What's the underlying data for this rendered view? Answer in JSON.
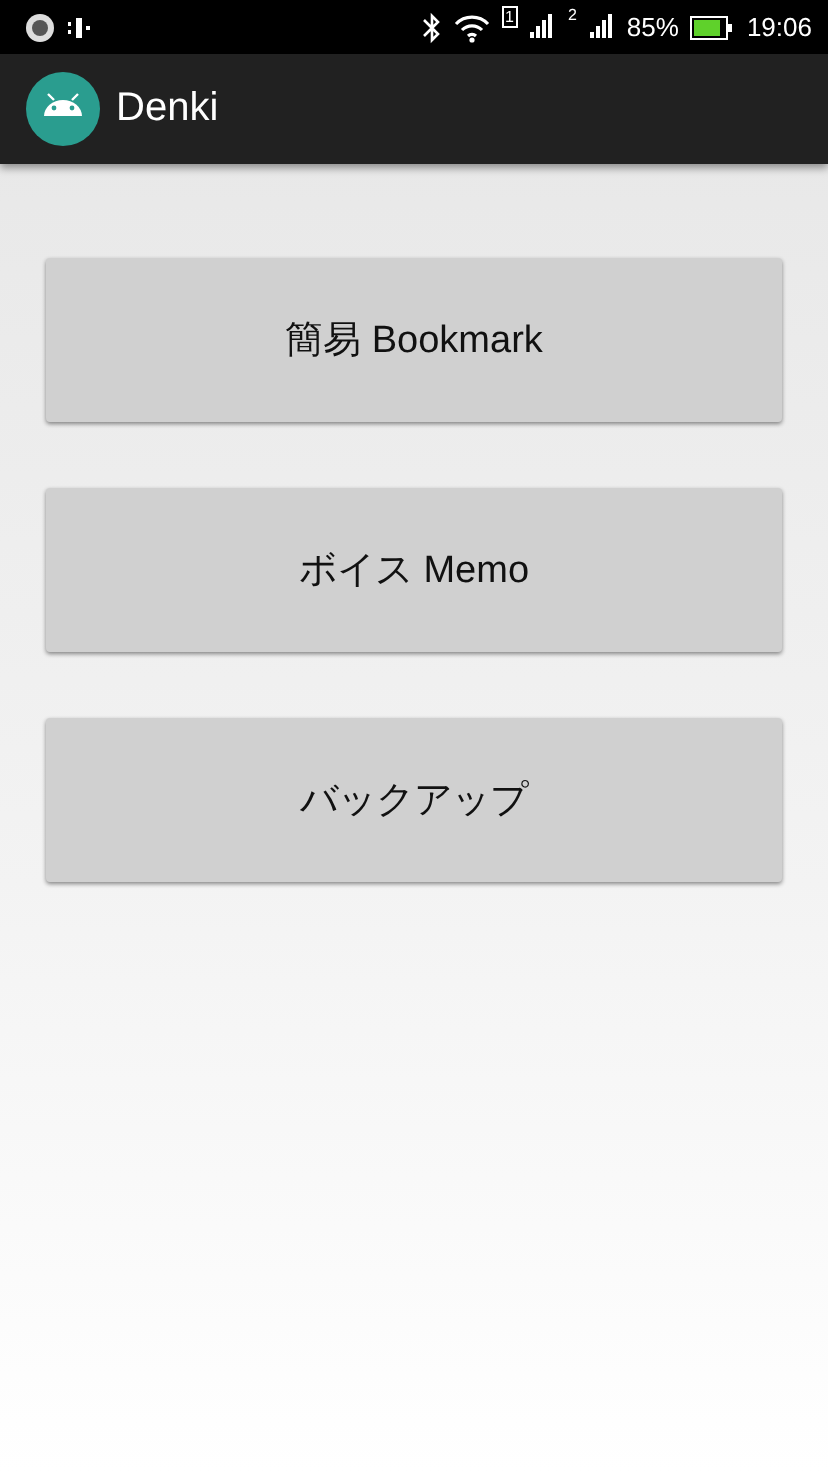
{
  "status_bar": {
    "sims": [
      {
        "label": "1"
      },
      {
        "label": "2"
      }
    ],
    "battery": "85%",
    "time": "19:06"
  },
  "app_bar": {
    "title": "Denki"
  },
  "buttons": [
    {
      "label": "簡易 Bookmark"
    },
    {
      "label": "ボイス Memo"
    },
    {
      "label": "バックアップ"
    }
  ]
}
